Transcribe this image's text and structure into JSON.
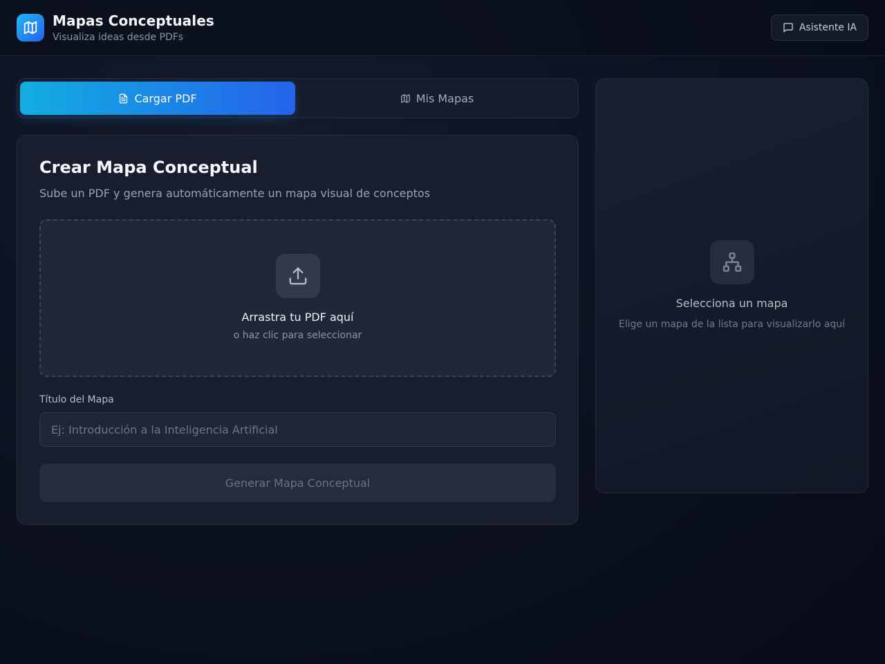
{
  "header": {
    "title": "Mapas Conceptuales",
    "subtitle": "Visualiza ideas desde PDFs",
    "assistant_label": "Asistente IA",
    "logo_icon": "map-icon",
    "assistant_icon": "message-square-icon"
  },
  "tabs": [
    {
      "label": "Cargar PDF",
      "icon": "file-text-icon",
      "active": true
    },
    {
      "label": "Mis Mapas",
      "icon": "map-icon",
      "active": false
    }
  ],
  "create_card": {
    "title": "Crear Mapa Conceptual",
    "subtitle": "Sube un PDF y genera automáticamente un mapa visual de conceptos",
    "dropzone": {
      "icon": "upload-icon",
      "title": "Arrastra tu PDF aquí",
      "subtitle": "o haz clic para seleccionar"
    },
    "title_field": {
      "label": "Título del Mapa",
      "placeholder": "Ej: Introducción a la Inteligencia Artificial",
      "value": ""
    },
    "generate_label": "Generar Mapa Conceptual"
  },
  "side_panel": {
    "icon": "network-icon",
    "title": "Selecciona un mapa",
    "subtitle": "Elige un mapa de la lista para visualizarlo aquí"
  },
  "colors": {
    "accent_start": "#12aee0",
    "accent_end": "#2563eb",
    "background": "#0c1120"
  }
}
